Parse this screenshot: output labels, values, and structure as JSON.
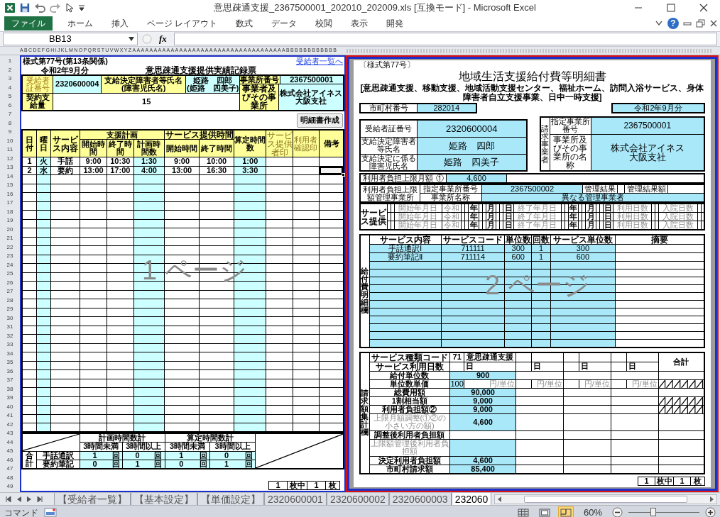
{
  "window": {
    "title": "意思疎通支援_2367500001_202010_202009.xls [互換モード] - Microsoft Excel"
  },
  "ribbon": {
    "tabs": [
      {
        "label": "ファイル",
        "kind": "file"
      },
      {
        "label": "ホーム",
        "kind": "tab"
      },
      {
        "label": "挿入",
        "kind": "tab"
      },
      {
        "label": "ページ レイアウト",
        "kind": "tab"
      },
      {
        "label": "数式",
        "kind": "tab"
      },
      {
        "label": "データ",
        "kind": "tab"
      },
      {
        "label": "校閲",
        "kind": "tab"
      },
      {
        "label": "表示",
        "kind": "tab"
      },
      {
        "label": "開発",
        "kind": "tab"
      }
    ],
    "help": "?"
  },
  "formula_bar": {
    "name_box": "BB13",
    "fx": "fx"
  },
  "column_headers": "ABCDEFGHIJKLMNOPQRSTUVWXYZAAAAAAAAAAAAAAAAAAAAAAAAAAAAAAAAAAAABBBBBBBBBBBB",
  "row_numbers": [
    "1",
    "2",
    "3",
    "4",
    "5",
    "6",
    "7",
    "8",
    "9",
    "10",
    "11",
    "12",
    "13",
    "14",
    "15",
    "16",
    "17",
    "18",
    "19",
    "20",
    "21",
    "22",
    "23",
    "24",
    "25",
    "26",
    "27",
    "28",
    "29",
    "30",
    "31",
    "32",
    "33",
    "34",
    "35",
    "36",
    "37",
    "38",
    "39",
    "40",
    "41",
    "42",
    "43",
    "44",
    "45",
    "46",
    "47",
    "48",
    "49"
  ],
  "page1": {
    "form_no": "様式第77号(第13条関係)",
    "list_link": "受給者一覧へ",
    "month": "令和2年9月分",
    "title": "意思疎通支援提供実績記録票",
    "recipient_no_label": "受給者証番号",
    "recipient_no": "2320600004",
    "name_label": "支給決定障害者等氏名",
    "child_name_label": "(障害児氏名)",
    "name": "姫路　四郎",
    "child_name": "(姫路　四美子)",
    "office_no_label": "事業所番号",
    "office_no": "2367500001",
    "office_label": "事業者及びその事業所",
    "office_name": "株式会社アイネス",
    "office_branch": "大阪支社",
    "contract_label": "契約支給量",
    "contract": "15",
    "create_button": "明細書作成",
    "columns": {
      "date": "日付",
      "weekday": "曜日",
      "service": "サービス内容",
      "plan": "支援計画",
      "plan_start": "開始時間",
      "plan_end": "終了時間",
      "plan_hours": "計画時間数",
      "provided": "サービス提供時間",
      "provided_start": "開始時間",
      "provided_end": "終了時間",
      "counted_hours": "算定時間数",
      "provider_seal": "サービス提供者印",
      "user_seal": "利用者確認印",
      "remarks": "備考"
    },
    "rows": [
      {
        "date": "1",
        "weekday": "火",
        "service": "手話",
        "plan_start": "9:00",
        "plan_end": "10:30",
        "plan_hours": "1:30",
        "start": "9:00",
        "end": "10:00",
        "hours": "1:00",
        "selected": false
      },
      {
        "date": "2",
        "weekday": "水",
        "service": "要約",
        "plan_start": "13:00",
        "plan_end": "17:00",
        "plan_hours": "4:00",
        "start": "13:00",
        "end": "16:30",
        "hours": "3:30",
        "selected": true
      }
    ],
    "summary": {
      "plan_total": "計画時間数計",
      "plan_columns": [
        "3時間未満",
        "3時間以上"
      ],
      "counted_total": "算定時間数計",
      "counted_columns": [
        "3時間未満",
        "3時間以上"
      ],
      "total_label": "合計",
      "rows": [
        {
          "service": "手話通訳",
          "counts": [
            {
              "value": "1",
              "unit": "回"
            },
            {
              "value": "0",
              "unit": "回"
            },
            {
              "value": "1",
              "unit": "回"
            },
            {
              "value": "0",
              "unit": "回"
            }
          ]
        },
        {
          "service": "要約筆記",
          "counts": [
            {
              "value": "0",
              "unit": "回"
            },
            {
              "value": "1",
              "unit": "回"
            },
            {
              "value": "0",
              "unit": "回"
            },
            {
              "value": "1",
              "unit": "回"
            }
          ]
        }
      ]
    },
    "page_count": [
      "1",
      "枚中",
      "1",
      "枚"
    ],
    "page_label": "1 ページ"
  },
  "page2": {
    "form_no": "〔様式第77号〕",
    "title": "地域生活支援給付費等明細書",
    "subtitle": "[意思疎通支援、移動支援、地域活動支援センター、福祉ホーム、訪問入浴サービス、身体障害者自立支援事業、日中一時支援]",
    "municipality_label": "市町村番号",
    "municipality_no": "282014",
    "month": "令和2年9月分",
    "recipient": [
      {
        "label": "受給者証番号",
        "value": "2320600004"
      },
      {
        "label": "支給決定障害者等氏名",
        "value": "姫路　四郎"
      },
      {
        "label": "支給決定に係る障害児氏名",
        "value": "姫路　四美子"
      }
    ],
    "biller_label": "請求事業者",
    "office_no_label": "指定事業所番号",
    "office_no": "2367500001",
    "office_name_label": "事業所及びその事業所の名称",
    "office_name": "株式会社アイネス",
    "office_branch": "大阪支社",
    "limit_label": "利用者負担上限月額 ①",
    "limit": "4,600",
    "management": {
      "label": "利用者負担上限額管理事業所",
      "office_no_label": "指定事業所番号",
      "office_no": "2367500002",
      "result_label": "管理結果",
      "result_amount_label": "管理結果額",
      "name_label": "事業所名称",
      "name": "異なる管理事業者"
    },
    "service_period": {
      "label": "サービス提供",
      "rows": [
        {
          "labels": [
            "開始年月日",
            "令和",
            "年",
            "月",
            "日",
            "終了年月日",
            "年",
            "月",
            "日",
            "利用日数",
            "入院日数"
          ]
        },
        {
          "labels": [
            "開始年月日",
            "令和",
            "年",
            "月",
            "日",
            "終了年月日",
            "年",
            "月",
            "日",
            "利用日数",
            "入院日数"
          ]
        },
        {
          "labels": [
            "開始年月日",
            "令和",
            "年",
            "月",
            "日",
            "終了年月日",
            "年",
            "月",
            "日",
            "利用日数",
            "入院日数"
          ]
        }
      ]
    },
    "items": {
      "label": "給付費明細欄",
      "columns": [
        "サービス内容",
        "サービスコード",
        "単位数",
        "回数",
        "サービス単位数",
        "摘要"
      ],
      "rows": [
        {
          "service": "手話通訳Ⅰ",
          "code": "711111",
          "units": "300",
          "count": "1",
          "service_units": "300"
        },
        {
          "service": "要約筆記Ⅱ",
          "code": "711114",
          "units": "600",
          "count": "1",
          "service_units": "600"
        }
      ]
    },
    "billing": {
      "label": "請求額集計欄",
      "rows": [
        {
          "kind": "code",
          "label": "サービス種類コード",
          "code": "71",
          "name": "意思疎通支援",
          "total_label": "合計"
        },
        {
          "kind": "days",
          "label": "サービス利用日数",
          "units": [
            "日",
            "日",
            "日",
            "日"
          ]
        },
        {
          "kind": "amount",
          "label": "給付単位数",
          "value": "900",
          "highlight": true,
          "hatched": false
        },
        {
          "kind": "unit_price",
          "label": "単位数単価",
          "value": "100",
          "units": [
            "円/単位",
            "円/単位",
            "円/単位",
            "円/単位"
          ],
          "hatched": true
        },
        {
          "kind": "amount",
          "label": "総費用額",
          "value": "90,000",
          "highlight": true,
          "hatched": false
        },
        {
          "kind": "amount",
          "label": "1割相当額",
          "value": "9,000",
          "highlight": true,
          "hatched": true
        },
        {
          "kind": "amount",
          "label": "利用者負担額②",
          "value": "9,000",
          "highlight": true,
          "hatched": true
        },
        {
          "kind": "amount",
          "label": "上限月額調整(①②の小さい方の額)",
          "value": "4,600",
          "highlight": true,
          "hatched": false,
          "muted": true
        },
        {
          "kind": "amount",
          "label": "調整後利用者負担額",
          "highlight": false,
          "hatched": false
        },
        {
          "kind": "amount",
          "label": "上限額管理後利用者負担額",
          "highlight": true,
          "hatched": false,
          "muted": true
        },
        {
          "kind": "amount",
          "label": "決定利用者負担額",
          "value": "4,600",
          "highlight": true,
          "hatched": false
        },
        {
          "kind": "amount",
          "label": "市町村請求額",
          "value": "85,400",
          "highlight": true,
          "hatched": false
        }
      ]
    },
    "page_count": [
      "1",
      "枚中",
      "1",
      "枚"
    ],
    "page_label": "2 ページ"
  },
  "sheet_tabs": [
    {
      "label": "【受給者一覧】",
      "selected": false
    },
    {
      "label": "【基本設定】",
      "selected": false
    },
    {
      "label": "【単価設定】",
      "selected": false
    },
    {
      "label": "2320600001",
      "selected": false
    },
    {
      "label": "2320600002",
      "selected": false
    },
    {
      "label": "2320600003",
      "selected": false
    },
    {
      "label": "232060",
      "selected": true
    }
  ],
  "status_bar": {
    "mode": "コマンド",
    "views": [
      {
        "selected": false
      },
      {
        "selected": false
      },
      {
        "selected": true
      }
    ],
    "zoom": "60%",
    "zoom_slider": {
      "level": 0.35
    }
  }
}
